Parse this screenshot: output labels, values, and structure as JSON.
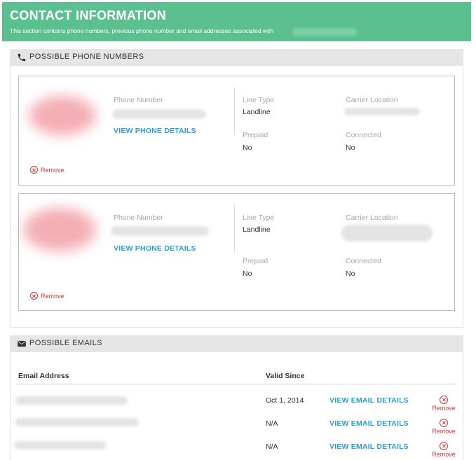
{
  "header": {
    "title": "CONTACT INFORMATION",
    "subtitle": "This section contains phone numbers, previous phone number and email addresses associated with"
  },
  "phones_section": {
    "title": "POSSIBLE PHONE NUMBERS",
    "icon": "phone-icon",
    "cards": [
      {
        "phone_label": "Phone Number",
        "details_link": "VIEW PHONE DETAILS",
        "line_type_label": "Line Type",
        "line_type_value": "Landline",
        "carrier_label": "Carrier Location",
        "prepaid_label": "Prepaid",
        "prepaid_value": "No",
        "connected_label": "Connected",
        "connected_value": "No",
        "remove_label": "Remove"
      },
      {
        "phone_label": "Phone Number",
        "details_link": "VIEW PHONE DETAILS",
        "line_type_label": "Line Type",
        "line_type_value": "Landline",
        "carrier_label": "Carrier Location",
        "prepaid_label": "Prepaid",
        "prepaid_value": "No",
        "connected_label": "Connected",
        "connected_value": "No",
        "remove_label": "Remove"
      }
    ]
  },
  "emails_section": {
    "title": "POSSIBLE EMAILS",
    "icon": "envelope-icon",
    "columns": {
      "email": "Email Address",
      "valid_since": "Valid Since"
    },
    "rows": [
      {
        "valid_since": "Oct 1, 2014",
        "details_link": "VIEW EMAIL DETAILS",
        "remove_label": "Remove"
      },
      {
        "valid_since": "N/A",
        "details_link": "VIEW EMAIL DETAILS",
        "remove_label": "Remove"
      },
      {
        "valid_since": "N/A",
        "details_link": "VIEW EMAIL DETAILS",
        "remove_label": "Remove"
      }
    ]
  },
  "colors": {
    "header_bg": "#5bbf8f",
    "link": "#2a9fd6",
    "remove": "#d9352f"
  }
}
